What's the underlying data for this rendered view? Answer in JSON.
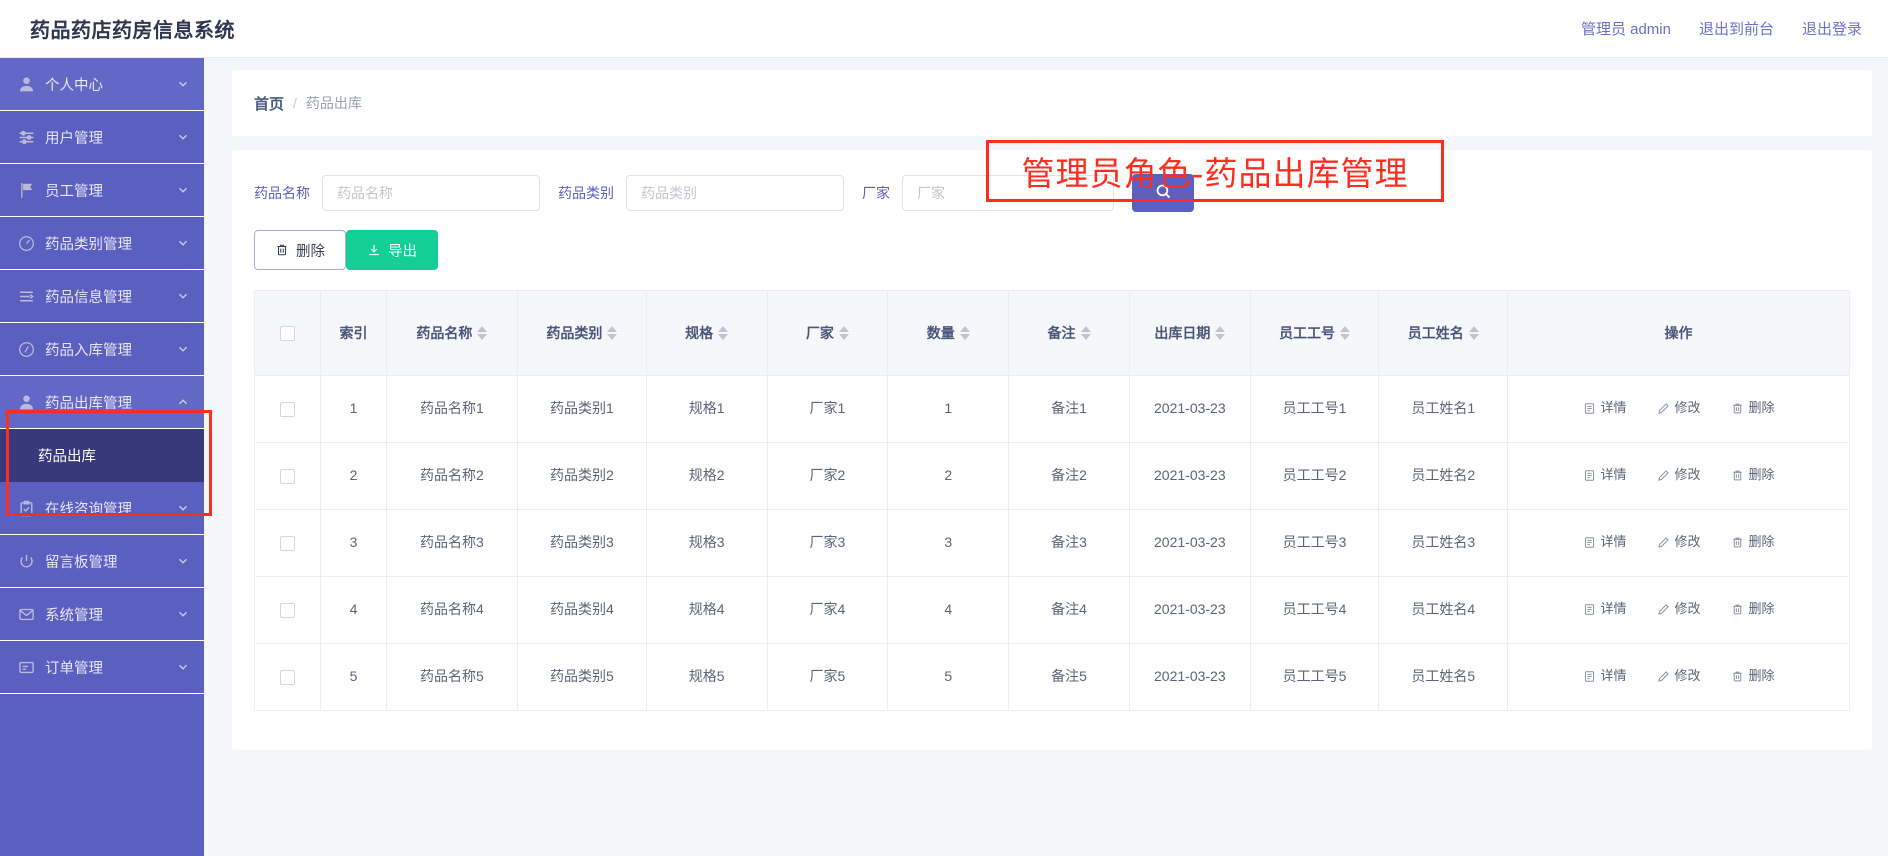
{
  "header": {
    "brand": "药品药店药房信息系统",
    "links": [
      {
        "label": "管理员 admin",
        "name": "admin-user-link"
      },
      {
        "label": "退出到前台",
        "name": "exit-to-front-link"
      },
      {
        "label": "退出登录",
        "name": "logout-link"
      }
    ]
  },
  "sidebar": {
    "items": [
      {
        "label": "个人中心",
        "icon": "user-icon",
        "expanded": false
      },
      {
        "label": "用户管理",
        "icon": "sliders-icon",
        "expanded": false
      },
      {
        "label": "员工管理",
        "icon": "flag-icon",
        "expanded": false
      },
      {
        "label": "药品类别管理",
        "icon": "clock-icon",
        "expanded": false
      },
      {
        "label": "药品信息管理",
        "icon": "list-icon",
        "expanded": false
      },
      {
        "label": "药品入库管理",
        "icon": "gauge-icon",
        "expanded": false
      },
      {
        "label": "药品出库管理",
        "icon": "user-icon",
        "expanded": true
      },
      {
        "label": "在线咨询管理",
        "icon": "clipboard-icon",
        "expanded": false
      },
      {
        "label": "留言板管理",
        "icon": "power-icon",
        "expanded": false
      },
      {
        "label": "系统管理",
        "icon": "mail-icon",
        "expanded": false
      },
      {
        "label": "订单管理",
        "icon": "message-icon",
        "expanded": false
      }
    ],
    "submenu": {
      "label": "药品出库",
      "parent": "药品出库管理"
    }
  },
  "breadcrumb": {
    "home": "首页",
    "separator": "/",
    "current": "药品出库"
  },
  "annotation": {
    "text": "管理员角色-药品出库管理",
    "color": "#ff2d20"
  },
  "search": {
    "fields": [
      {
        "label": "药品名称",
        "placeholder": "药品名称",
        "value": ""
      },
      {
        "label": "药品类别",
        "placeholder": "药品类别",
        "value": ""
      },
      {
        "label": "厂家",
        "placeholder": "厂家",
        "value": ""
      }
    ],
    "button_icon": "search-icon"
  },
  "toolbar": {
    "delete_label": "删除",
    "delete_icon": "trash-icon",
    "export_label": "导出",
    "export_icon": "download-icon",
    "export_color": "#13ce97"
  },
  "table": {
    "columns": [
      {
        "label": "",
        "sortable": false,
        "name": "select-all"
      },
      {
        "label": "索引",
        "sortable": false
      },
      {
        "label": "药品名称",
        "sortable": true
      },
      {
        "label": "药品类别",
        "sortable": true
      },
      {
        "label": "规格",
        "sortable": true
      },
      {
        "label": "厂家",
        "sortable": true
      },
      {
        "label": "数量",
        "sortable": true
      },
      {
        "label": "备注",
        "sortable": true
      },
      {
        "label": "出库日期",
        "sortable": true
      },
      {
        "label": "员工工号",
        "sortable": true
      },
      {
        "label": "员工姓名",
        "sortable": true
      },
      {
        "label": "操作",
        "sortable": false
      }
    ],
    "row_actions": [
      {
        "label": "详情",
        "icon": "detail-icon"
      },
      {
        "label": "修改",
        "icon": "edit-icon"
      },
      {
        "label": "删除",
        "icon": "trash-icon"
      }
    ],
    "rows": [
      {
        "index": "1",
        "drug_name": "药品名称1",
        "category": "药品类别1",
        "spec": "规格1",
        "factory": "厂家1",
        "qty": "1",
        "remark": "备注1",
        "out_date": "2021-03-23",
        "emp_no": "员工工号1",
        "emp_name": "员工姓名1"
      },
      {
        "index": "2",
        "drug_name": "药品名称2",
        "category": "药品类别2",
        "spec": "规格2",
        "factory": "厂家2",
        "qty": "2",
        "remark": "备注2",
        "out_date": "2021-03-23",
        "emp_no": "员工工号2",
        "emp_name": "员工姓名2"
      },
      {
        "index": "3",
        "drug_name": "药品名称3",
        "category": "药品类别3",
        "spec": "规格3",
        "factory": "厂家3",
        "qty": "3",
        "remark": "备注3",
        "out_date": "2021-03-23",
        "emp_no": "员工工号3",
        "emp_name": "员工姓名3"
      },
      {
        "index": "4",
        "drug_name": "药品名称4",
        "category": "药品类别4",
        "spec": "规格4",
        "factory": "厂家4",
        "qty": "4",
        "remark": "备注4",
        "out_date": "2021-03-23",
        "emp_no": "员工工号4",
        "emp_name": "员工姓名4"
      },
      {
        "index": "5",
        "drug_name": "药品名称5",
        "category": "药品类别5",
        "spec": "规格5",
        "factory": "厂家5",
        "qty": "5",
        "remark": "备注5",
        "out_date": "2021-03-23",
        "emp_no": "员工工号5",
        "emp_name": "员工姓名5"
      }
    ]
  },
  "colors": {
    "sidebar": "#5b5fc0",
    "submenu_active": "#363a7a",
    "accent": "#5b5fc0",
    "annotation": "#ff2d20",
    "export_green": "#13ce97"
  }
}
